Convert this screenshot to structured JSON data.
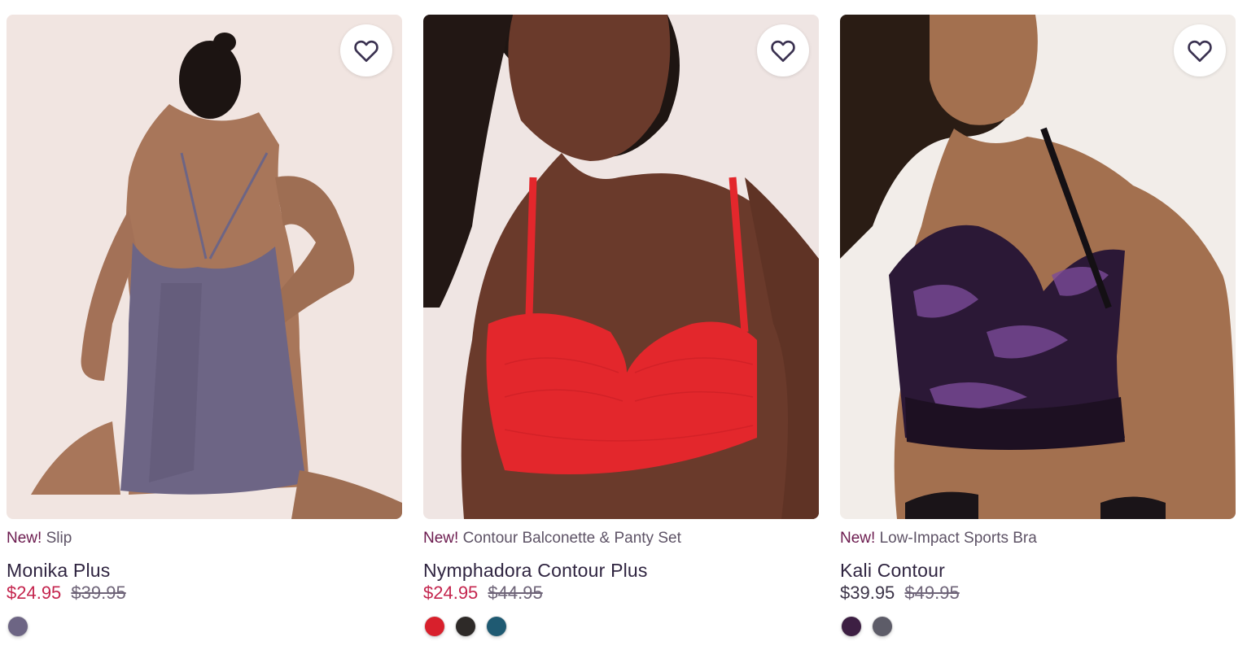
{
  "products": [
    {
      "badge": "New!",
      "category": "Slip",
      "name": "Monika Plus",
      "price_current": "$24.95",
      "price_original": "$39.95",
      "on_sale": true,
      "favorite_icon": "heart-outline-icon",
      "swatches": [
        {
          "name": "lavender-gray",
          "color": "#6d6584"
        }
      ]
    },
    {
      "badge": "New!",
      "category": "Contour Balconette & Panty Set",
      "name": "Nymphadora Contour Plus",
      "price_current": "$24.95",
      "price_original": "$44.95",
      "on_sale": true,
      "favorite_icon": "heart-outline-icon",
      "swatches": [
        {
          "name": "red",
          "color": "#d8202c"
        },
        {
          "name": "black-floral",
          "color": "#2e2a28"
        },
        {
          "name": "teal-print",
          "color": "#1f5a72"
        }
      ]
    },
    {
      "badge": "New!",
      "category": "Low-Impact Sports Bra",
      "name": "Kali Contour",
      "price_current": "$39.95",
      "price_original": "$49.95",
      "on_sale": false,
      "favorite_icon": "heart-outline-icon",
      "swatches": [
        {
          "name": "purple-tie-dye",
          "color": "#3d1f43"
        },
        {
          "name": "gray-tie-dye",
          "color": "#5d5c68"
        }
      ]
    }
  ],
  "colors": {
    "sale_price": "#c4254e",
    "badge": "#6b1a4e",
    "text": "#2f2440",
    "heart_stroke": "#3a3150"
  }
}
